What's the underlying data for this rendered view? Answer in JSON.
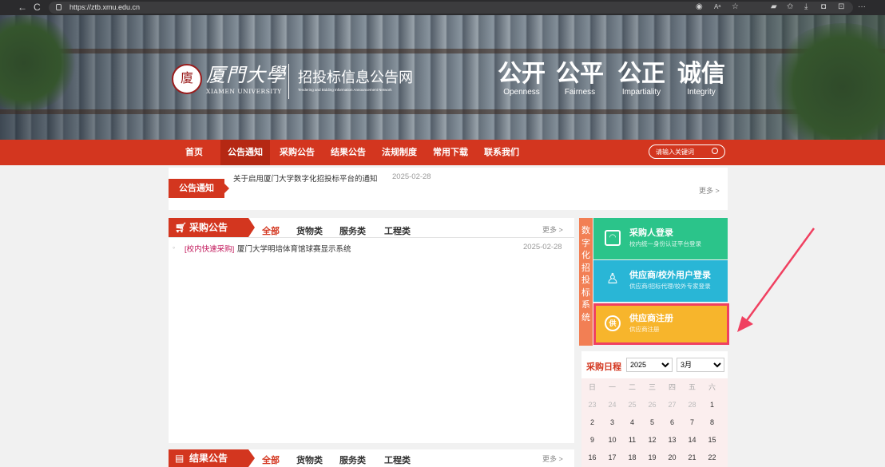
{
  "browser": {
    "url": "https://ztb.xmu.edu.cn",
    "back_glyph": "←",
    "reload_glyph": "C",
    "toolbar_icons": [
      "reader-view-icon",
      "read-aloud-icon",
      "favorite-star-icon",
      "screen-icon",
      "collections-icon",
      "download-icon",
      "extensions-icon",
      "split-screen-icon",
      "more-icon"
    ]
  },
  "banner": {
    "logo_glyph": "廈",
    "university_cn": "厦門大學",
    "university_en": "XIAMEN UNIVERSITY",
    "site_title": "招投标信息公告网",
    "site_subtitle": "Tendering and Bidding Information Announcement Network",
    "slogans": [
      {
        "cn": "公开",
        "en": "Openness"
      },
      {
        "cn": "公平",
        "en": "Fairness"
      },
      {
        "cn": "公正",
        "en": "Impartiality"
      },
      {
        "cn": "诚信",
        "en": "Integrity"
      }
    ]
  },
  "nav": {
    "items": [
      "首页",
      "公告通知",
      "采购公告",
      "结果公告",
      "法规制度",
      "常用下载",
      "联系我们"
    ],
    "active": "公告通知",
    "search_placeholder": "请输入关键词"
  },
  "notice": {
    "label": "公告通知",
    "items": [
      {
        "title": "关于启用厦门大学数字化招投标平台的通知",
        "date": "2025-02-28"
      }
    ],
    "more": "更多 >"
  },
  "procurement": {
    "title": "采购公告",
    "tabs": [
      "全部",
      "货物类",
      "服务类",
      "工程类"
    ],
    "active_tab": "全部",
    "more": "更多 >",
    "rows": [
      {
        "bullet": "◦",
        "tag": "[校内快速采购]",
        "title": "厦门大学明培体育馆球赛显示系统",
        "date": "2025-02-28"
      }
    ]
  },
  "results": {
    "title": "结果公告",
    "tabs": [
      "全部",
      "货物类",
      "服务类",
      "工程类"
    ],
    "active_tab": "全部",
    "more": "更多 >"
  },
  "digital_system": {
    "vertical_label": [
      "数",
      "字",
      "化",
      "招",
      "投",
      "标",
      "系",
      "统"
    ],
    "tiles": [
      {
        "title": "采购人登录",
        "subtitle": "校内统一身份认证平台登录",
        "icon_glyph": "◠",
        "color": "#2bc48a"
      },
      {
        "title": "供应商/校外用户登录",
        "subtitle": "供应商/招标代理/校外专家登录",
        "icon_glyph": "♙",
        "color": "#29b6d6"
      },
      {
        "title": "供应商注册",
        "subtitle": "供应商注册",
        "icon_glyph": "供",
        "color": "#f7b52c"
      }
    ]
  },
  "calendar": {
    "title": "采购日程",
    "year": "2025",
    "month": "3月",
    "weekdays": [
      "日",
      "一",
      "二",
      "三",
      "四",
      "五",
      "六"
    ],
    "rows": [
      [
        {
          "d": "23",
          "dim": true
        },
        {
          "d": "24",
          "dim": true
        },
        {
          "d": "25",
          "dim": true
        },
        {
          "d": "26",
          "dim": true
        },
        {
          "d": "27",
          "dim": true
        },
        {
          "d": "28",
          "dim": true
        },
        {
          "d": "1",
          "dim": false
        }
      ],
      [
        {
          "d": "2",
          "dim": false
        },
        {
          "d": "3",
          "dim": false
        },
        {
          "d": "4",
          "dim": false
        },
        {
          "d": "5",
          "dim": false
        },
        {
          "d": "6",
          "dim": false
        },
        {
          "d": "7",
          "dim": false
        },
        {
          "d": "8",
          "dim": false
        }
      ],
      [
        {
          "d": "9",
          "dim": false
        },
        {
          "d": "10",
          "dim": false
        },
        {
          "d": "11",
          "dim": false
        },
        {
          "d": "12",
          "dim": false
        },
        {
          "d": "13",
          "dim": false
        },
        {
          "d": "14",
          "dim": false
        },
        {
          "d": "15",
          "dim": false
        }
      ],
      [
        {
          "d": "16",
          "dim": false
        },
        {
          "d": "17",
          "dim": false
        },
        {
          "d": "18",
          "dim": false
        },
        {
          "d": "19",
          "dim": false
        },
        {
          "d": "20",
          "dim": false
        },
        {
          "d": "21",
          "dim": false
        },
        {
          "d": "22",
          "dim": false
        }
      ]
    ]
  },
  "colors": {
    "brand_red": "#d3361f",
    "annotation_red": "#f04060"
  }
}
